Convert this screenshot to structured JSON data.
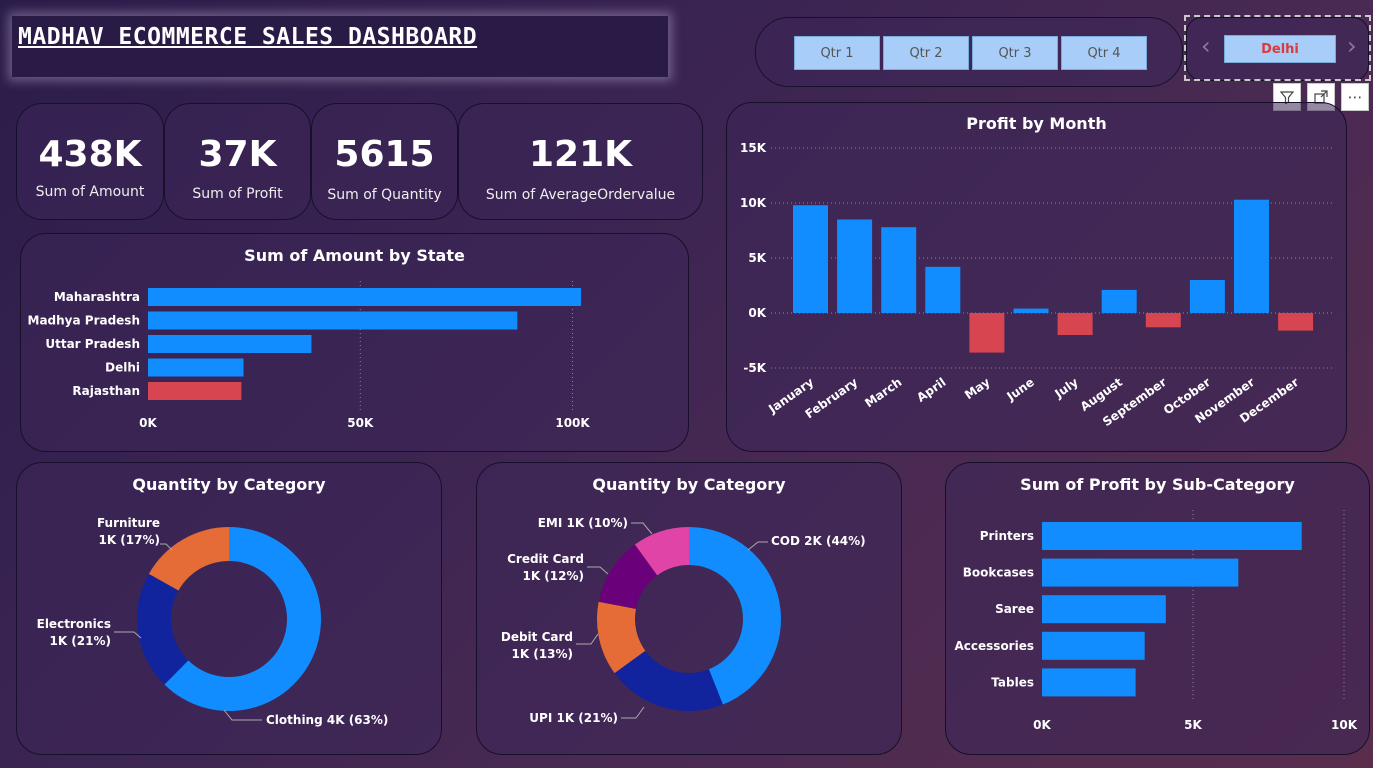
{
  "header": {
    "title": "MADHAV ECOMMERCE SALES DASHBOARD"
  },
  "quarter_slicer": {
    "options": [
      "Qtr 1",
      "Qtr 2",
      "Qtr 3",
      "Qtr 4"
    ]
  },
  "city_slicer": {
    "selected": "Delhi",
    "prev_icon": "chevron-left-icon",
    "next_icon": "chevron-right-icon"
  },
  "toolbar": {
    "icons": [
      "filter-icon",
      "focus-mode-icon",
      "more-options-icon"
    ]
  },
  "kpis": [
    {
      "value": "438K",
      "label": "Sum of Amount"
    },
    {
      "value": "37K",
      "label": "Sum of Profit"
    },
    {
      "value": "5615",
      "label": "Sum of Quantity"
    },
    {
      "value": "121K",
      "label": "Sum of AverageOrdervalue"
    }
  ],
  "colors": {
    "positive": "#118dff",
    "negative": "#d64550",
    "electronics": "#12239e",
    "furniture": "#e66c37",
    "credit": "#6b007b",
    "emi": "#e044a7"
  },
  "chart_data": [
    {
      "id": "state",
      "type": "bar",
      "orientation": "horizontal",
      "title": "Sum of Amount by State",
      "categories": [
        "Maharashtra",
        "Madhya Pradesh",
        "Uttar Pradesh",
        "Delhi",
        "Rajasthan"
      ],
      "values": [
        102000,
        87000,
        38500,
        22500,
        22000
      ],
      "highlight": [
        "positive",
        "positive",
        "positive",
        "positive",
        "negative"
      ],
      "xlim": [
        0,
        110000
      ],
      "ticks": [
        0,
        50000,
        100000
      ],
      "tick_labels": [
        "0K",
        "50K",
        "100K"
      ]
    },
    {
      "id": "month",
      "type": "bar",
      "title": "Profit by Month",
      "categories": [
        "January",
        "February",
        "March",
        "April",
        "May",
        "June",
        "July",
        "August",
        "September",
        "October",
        "November",
        "December"
      ],
      "values": [
        9800,
        8500,
        7800,
        4200,
        -3600,
        400,
        -2000,
        2100,
        -1300,
        3000,
        10300,
        -1600
      ],
      "ylim": [
        -5000,
        15000
      ],
      "ticks": [
        -5000,
        0,
        5000,
        10000,
        15000
      ],
      "tick_labels": [
        "-5K",
        "0K",
        "5K",
        "10K",
        "15K"
      ],
      "grid": true
    },
    {
      "id": "cat",
      "type": "pie",
      "donut": true,
      "title": "Quantity by Category",
      "slices": [
        {
          "name": "Clothing",
          "value": 63,
          "label": "Clothing 4K (63%)",
          "color": "#118dff"
        },
        {
          "name": "Electronics",
          "value": 21,
          "label1": "Electronics",
          "label2": "1K (21%)",
          "color": "#12239e"
        },
        {
          "name": "Furniture",
          "value": 17,
          "label1": "Furniture",
          "label2": "1K (17%)",
          "color": "#e66c37"
        }
      ]
    },
    {
      "id": "pay",
      "type": "pie",
      "donut": true,
      "title": "Quantity by Category",
      "slices": [
        {
          "name": "COD",
          "value": 44,
          "label": "COD 2K (44%)",
          "color": "#118dff"
        },
        {
          "name": "UPI",
          "value": 21,
          "label": "UPI 1K (21%)",
          "color": "#12239e"
        },
        {
          "name": "Debit Card",
          "value": 13,
          "label1": "Debit Card",
          "label2": "1K (13%)",
          "color": "#e66c37"
        },
        {
          "name": "Credit Card",
          "value": 12,
          "label1": "Credit Card",
          "label2": "1K (12%)",
          "color": "#6b007b"
        },
        {
          "name": "EMI",
          "value": 10,
          "label": "EMI 1K (10%)",
          "color": "#e044a7"
        }
      ]
    },
    {
      "id": "sub",
      "type": "bar",
      "orientation": "horizontal",
      "title": "Sum of Profit by Sub-Category",
      "categories": [
        "Printers",
        "Bookcases",
        "Saree",
        "Accessories",
        "Tables"
      ],
      "values": [
        8600,
        6500,
        4100,
        3400,
        3100
      ],
      "xlim": [
        0,
        10000
      ],
      "ticks": [
        0,
        5000,
        10000
      ],
      "tick_labels": [
        "0K",
        "5K",
        "10K"
      ]
    }
  ]
}
